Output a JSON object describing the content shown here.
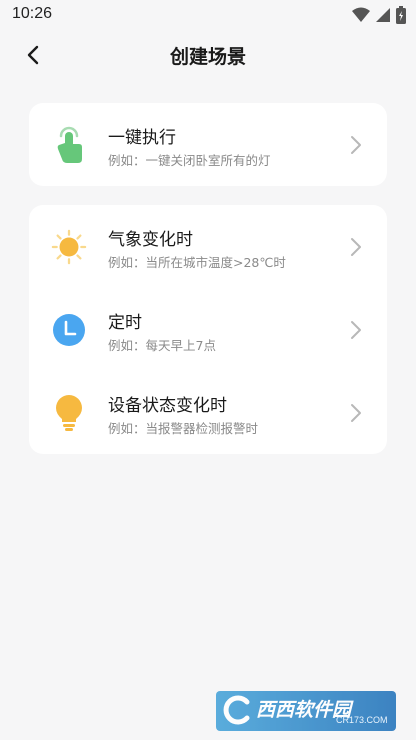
{
  "status_bar": {
    "time": "10:26",
    "icons": [
      "wifi-icon",
      "cellular-signal-icon",
      "battery-icon"
    ]
  },
  "header": {
    "title": "创建场景",
    "back_icon": "back-arrow-icon"
  },
  "manual_group": {
    "items": [
      {
        "title": "一键执行",
        "subtitle": "例如：一键关闭卧室所有的灯",
        "icon": "tap-hand-icon",
        "color": "#66c77a"
      }
    ]
  },
  "auto_group": {
    "items": [
      {
        "title": "气象变化时",
        "subtitle": "例如：当所在城市温度>28℃时",
        "icon": "sun-icon",
        "color": "#f6b940"
      },
      {
        "title": "定时",
        "subtitle": "例如：每天早上7点",
        "icon": "clock-icon",
        "color": "#4aa6f0"
      },
      {
        "title": "设备状态变化时",
        "subtitle": "例如：当报警器检测报警时",
        "icon": "lightbulb-icon",
        "color": "#f6b940"
      }
    ]
  },
  "watermark": {
    "text": "西西软件园",
    "sub": "CR173.COM"
  }
}
